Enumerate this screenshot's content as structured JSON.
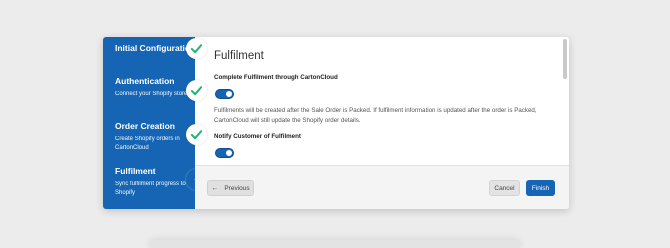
{
  "sidebar": {
    "steps": [
      {
        "title": "Initial Configuration",
        "subtitle": "",
        "status": "complete"
      },
      {
        "title": "Authentication",
        "subtitle": "Connect your Shopify store",
        "status": "complete"
      },
      {
        "title": "Order Creation",
        "subtitle": "Create Shopify orders in CartonCloud",
        "status": "complete"
      },
      {
        "title": "Fulfilment",
        "subtitle": "Sync fulfilment progress to Shopify",
        "status": "current",
        "number": "4"
      }
    ]
  },
  "main": {
    "heading": "Fulfilment",
    "settings": [
      {
        "label": "Complete Fulfilment through CartonCloud",
        "enabled": true
      },
      {
        "label": "Notify Customer of Fulfilment",
        "enabled": true
      }
    ],
    "description": "Fulfilments will be created after the Sale Order is Packed. If fulfilment information is updated after the order is Packed, CartonCloud will still update the Shopify order details."
  },
  "footer": {
    "previous_label": "Previous",
    "cancel_label": "Cancel",
    "finish_label": "Finish"
  },
  "colors": {
    "primary": "#1565b4",
    "check": "#21b573"
  }
}
